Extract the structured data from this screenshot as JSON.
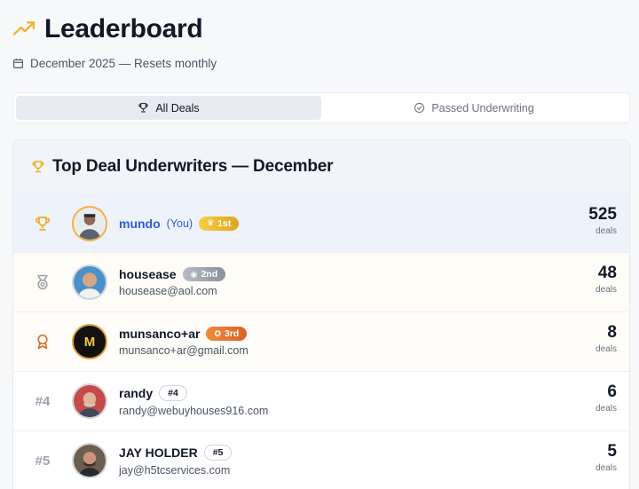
{
  "header": {
    "title": "Leaderboard",
    "subtitle": "December 2025 — Resets monthly",
    "title_icon": "trending-up-icon",
    "subtitle_icon": "calendar-icon"
  },
  "tabs": [
    {
      "label": "All Deals",
      "icon": "trophy-icon",
      "active": true
    },
    {
      "label": "Passed Underwriting",
      "icon": "check-circle-icon",
      "active": false
    }
  ],
  "card": {
    "title": "Top Deal Underwriters — December",
    "icon": "trophy-icon"
  },
  "colors": {
    "accent_blue": "#2f5bd8",
    "gold": "#e8b021",
    "silver": "#9aa0a8",
    "bronze": "#df6f2c"
  },
  "rows": [
    {
      "rank_icon": "trophy-icon",
      "name": "mundo",
      "you": "(You)",
      "badge": "1st",
      "email": "",
      "deals": "525",
      "deals_label": "deals"
    },
    {
      "rank_icon": "medal-icon",
      "name": "housease",
      "badge": "2nd",
      "email": "housease@aol.com",
      "deals": "48",
      "deals_label": "deals"
    },
    {
      "rank_icon": "award-icon",
      "name": "munsanco+ar",
      "badge": "3rd",
      "avatar_initial": "M",
      "email": "munsanco+ar@gmail.com",
      "deals": "8",
      "deals_label": "deals"
    },
    {
      "rank": "#4",
      "name": "randy",
      "badge": "#4",
      "email": "randy@webuyhouses916.com",
      "deals": "6",
      "deals_label": "deals"
    },
    {
      "rank": "#5",
      "name": "JAY HOLDER",
      "badge": "#5",
      "email": "jay@h5tcservices.com",
      "deals": "5",
      "deals_label": "deals"
    }
  ]
}
